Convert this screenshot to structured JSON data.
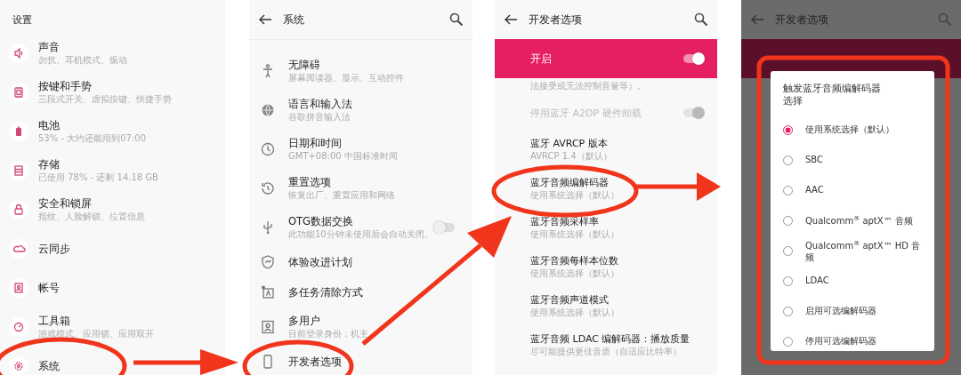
{
  "panels": [
    {
      "kind": "home",
      "title": "设置",
      "items": [
        {
          "title": "声音",
          "subtitle": "勿扰、耳机模式、振动"
        },
        {
          "title": "按键和手势",
          "subtitle": "三段式开关、虚拟按键、快捷手势"
        },
        {
          "title": "电池",
          "subtitle": "53% - 大约还能用到07:00"
        },
        {
          "title": "存储",
          "subtitle": "已使用 78% - 还剩 14.18 GB"
        },
        {
          "title": "安全和锁屏",
          "subtitle": "指纹、人脸解锁、位置信息"
        },
        {
          "title": "云同步"
        },
        {
          "title": "帐号"
        },
        {
          "title": "工具箱",
          "subtitle": "游戏模式、应用锁、应用双开"
        },
        {
          "title": "系统"
        }
      ]
    },
    {
      "kind": "list",
      "title": "系统",
      "items": [
        {
          "title": "无障碍",
          "subtitle": "屏幕阅读器、显示、互动控件"
        },
        {
          "title": "语言和输入法",
          "subtitle": "谷歌拼音输入法"
        },
        {
          "title": "日期和时间",
          "subtitle": "GMT+08:00 中国标准时间"
        },
        {
          "title": "重置选项",
          "subtitle": "恢复出厂、重置应用和网络"
        },
        {
          "title": "OTG数据交换",
          "subtitle": "此功能10分钟未使用后会自动关闭。",
          "toggle": {
            "on": false
          }
        },
        {
          "title": "体验改进计划"
        },
        {
          "title": "多任务清除方式"
        },
        {
          "title": "多用户",
          "subtitle": "目前登录身份：机主"
        },
        {
          "title": "开发者选项"
        }
      ]
    },
    {
      "kind": "developer",
      "title": "开发者选项",
      "master": {
        "label": "开启",
        "on": true
      },
      "note": "法接受或无法控制音量等）。",
      "items": [
        {
          "title": "停用蓝牙 A2DP 硬件卸载",
          "disabled": true,
          "toggle": {
            "on": true
          }
        },
        {
          "title": "蓝牙 AVRCP 版本",
          "subtitle": "AVRCP 1.4（默认）"
        },
        {
          "title": "蓝牙音频编解码器",
          "subtitle": "使用系统选择（默认）"
        },
        {
          "title": "蓝牙音频采样率",
          "subtitle": "使用系统选择（默认）"
        },
        {
          "title": "蓝牙音频每样本位数",
          "subtitle": "使用系统选择（默认）"
        },
        {
          "title": "蓝牙音频声道模式",
          "subtitle": "使用系统选择（默认）"
        },
        {
          "title": "蓝牙音频 LDAC 编解码器：播放质量",
          "subtitle": "尽可能提供更佳音质（自适应比特率）"
        }
      ]
    },
    {
      "kind": "dialog",
      "title": "开发者选项",
      "dialog": {
        "title": "触发蓝牙音频编解码器选择",
        "options": [
          {
            "label": "使用系统选择（默认）",
            "selected": true
          },
          {
            "label": "SBC",
            "selected": false
          },
          {
            "label": "AAC",
            "selected": false
          },
          {
            "label": "Qualcomm$^{®}$ aptX™ 音频",
            "selected": false
          },
          {
            "label": "Qualcomm$^{®}$ aptX™ HD 音频",
            "selected": false
          },
          {
            "label": "LDAC",
            "selected": false
          },
          {
            "label": "启用可选编解码器",
            "selected": false
          },
          {
            "label": "停用可选编解码器",
            "selected": false
          }
        ]
      }
    }
  ]
}
